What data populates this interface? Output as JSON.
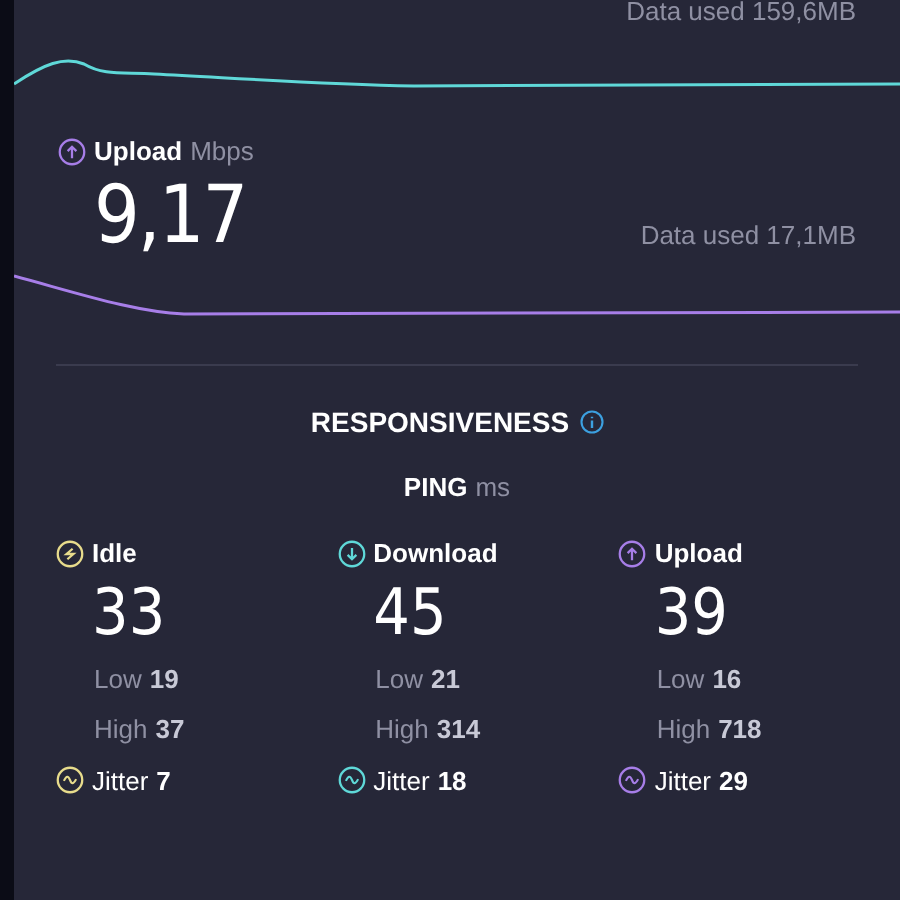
{
  "download": {
    "data_used": "Data used 159,6MB"
  },
  "upload": {
    "label": "Upload",
    "unit": "Mbps",
    "value": "9,17",
    "data_used": "Data used 17,1MB"
  },
  "responsiveness": {
    "title": "RESPONSIVENESS",
    "ping_label": "PING",
    "ping_unit": "ms",
    "columns": [
      {
        "kind": "idle",
        "color": "#e8dc8c",
        "label": "Idle",
        "value": "33",
        "low_label": "Low",
        "low": "19",
        "high_label": "High",
        "high": "37",
        "jitter_label": "Jitter",
        "jitter": "7"
      },
      {
        "kind": "download",
        "color": "#5fd8d8",
        "label": "Download",
        "value": "45",
        "low_label": "Low",
        "low": "21",
        "high_label": "High",
        "high": "314",
        "jitter_label": "Jitter",
        "jitter": "18"
      },
      {
        "kind": "upload",
        "color": "#a77ee8",
        "label": "Upload",
        "value": "39",
        "low_label": "Low",
        "low": "16",
        "high_label": "High",
        "high": "718",
        "jitter_label": "Jitter",
        "jitter": "29"
      }
    ]
  }
}
